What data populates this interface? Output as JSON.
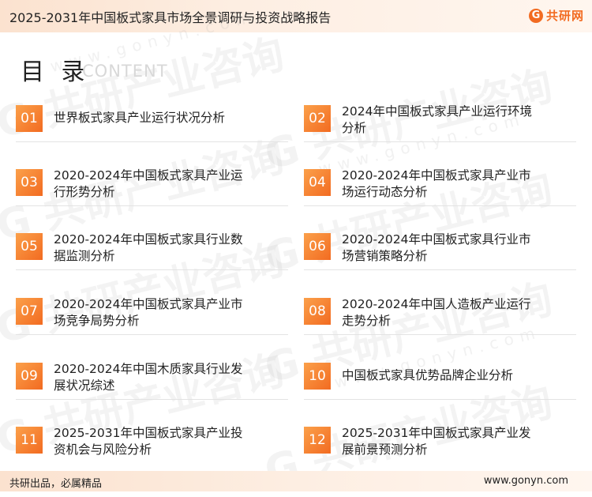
{
  "header": {
    "title": "2025-2031年中国板式家具市场全景调研与投资战略报告",
    "logo_mark": "G",
    "logo_text": "共研网"
  },
  "watermark": {
    "text": "G 共研产业咨询",
    "url": "www.gonyn.com"
  },
  "toc": {
    "heading": "目 录",
    "subheading": "CONTENT",
    "items": [
      {
        "num": "01",
        "line1": "世界板式家具产业运行状况分析",
        "line2": ""
      },
      {
        "num": "02",
        "line1": "2024年中国板式家具产业运行环境",
        "line2": "分析"
      },
      {
        "num": "03",
        "line1": "2020-2024年中国板式家具产业运",
        "line2": "行形势分析"
      },
      {
        "num": "04",
        "line1": "2020-2024年中国板式家具产业市",
        "line2": "场运行动态分析"
      },
      {
        "num": "05",
        "line1": "2020-2024年中国板式家具行业数",
        "line2": "据监测分析"
      },
      {
        "num": "06",
        "line1": "2020-2024年中国板式家具行业市",
        "line2": "场营销策略分析"
      },
      {
        "num": "07",
        "line1": "2020-2024年中国板式家具产业市",
        "line2": "场竞争局势分析"
      },
      {
        "num": "08",
        "line1": "2020-2024年中国人造板产业运行",
        "line2": "走势分析"
      },
      {
        "num": "09",
        "line1": "2020-2024年中国木质家具行业发",
        "line2": "展状况综述"
      },
      {
        "num": "10",
        "line1": "中国板式家具优势品牌企业分析",
        "line2": ""
      },
      {
        "num": "11",
        "line1": "2025-2031年中国板式家具产业投",
        "line2": "资机会与风险分析"
      },
      {
        "num": "12",
        "line1": "2025-2031年中国板式家具产业发",
        "line2": "展前景预测分析"
      }
    ]
  },
  "footer": {
    "left": "共研出品，必属精品",
    "right": "www.gonyn.com"
  },
  "colors": {
    "accent": "#f26b21",
    "accent_light": "#fba04a",
    "band": "#fbe2cf"
  }
}
